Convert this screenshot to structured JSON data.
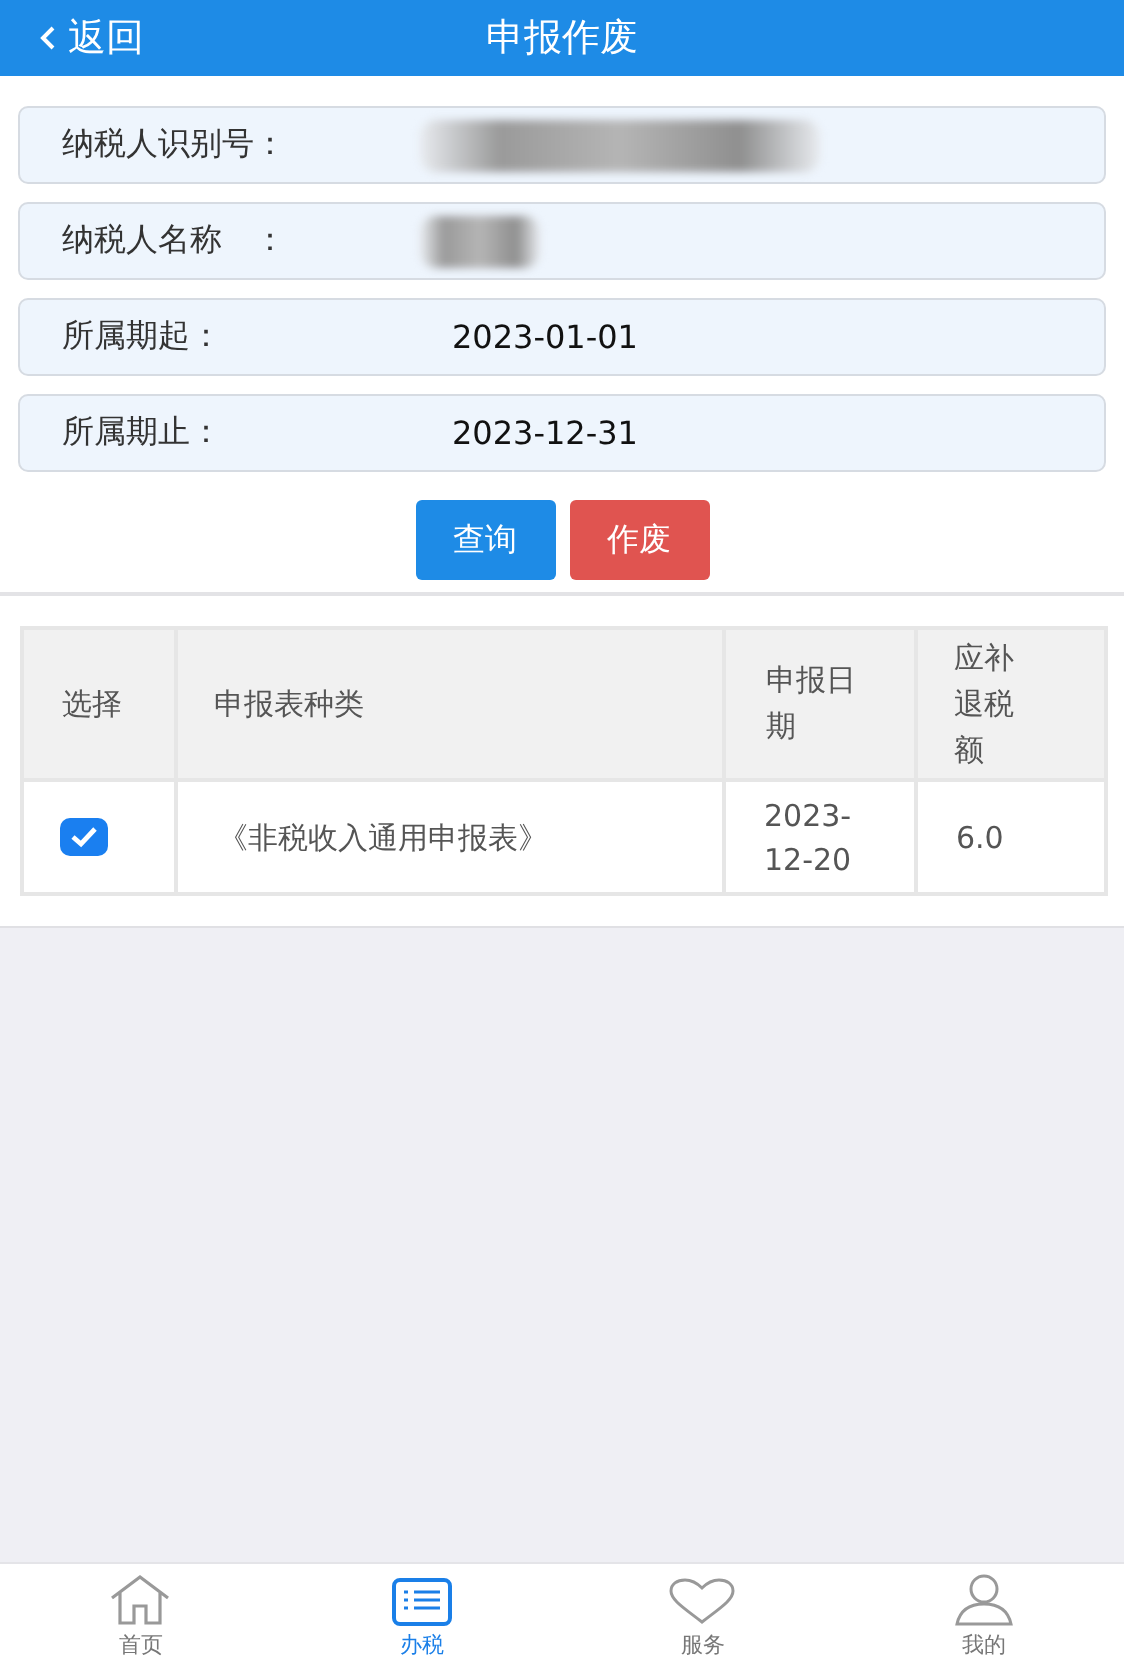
{
  "header": {
    "back": "返回",
    "title": "申报作废"
  },
  "fields": [
    {
      "label": "纳税人识别号：",
      "kind": "redacted"
    },
    {
      "label": "纳税人名称　：",
      "kind": "redacted"
    },
    {
      "label": "所属期起：",
      "kind": "text",
      "value": "2023-01-01"
    },
    {
      "label": "所属期止：",
      "kind": "text",
      "value": "2023-12-31"
    }
  ],
  "buttons": [
    {
      "label": "查询",
      "kind": "primary"
    },
    {
      "label": "作废",
      "kind": "danger"
    }
  ],
  "table": {
    "columns": [
      "选择",
      "申报表种类",
      "申报日期",
      "应补退税额"
    ],
    "rows": [
      {
        "selected": true,
        "cells": [
          "",
          "《非税收入通用申报表》",
          "2023-12-20",
          "6.0"
        ]
      }
    ]
  },
  "tab_bar": [
    {
      "label": "首页",
      "selected": false
    },
    {
      "label": "办税",
      "selected": true
    },
    {
      "label": "服务",
      "selected": false
    },
    {
      "label": "我的",
      "selected": false
    }
  ]
}
